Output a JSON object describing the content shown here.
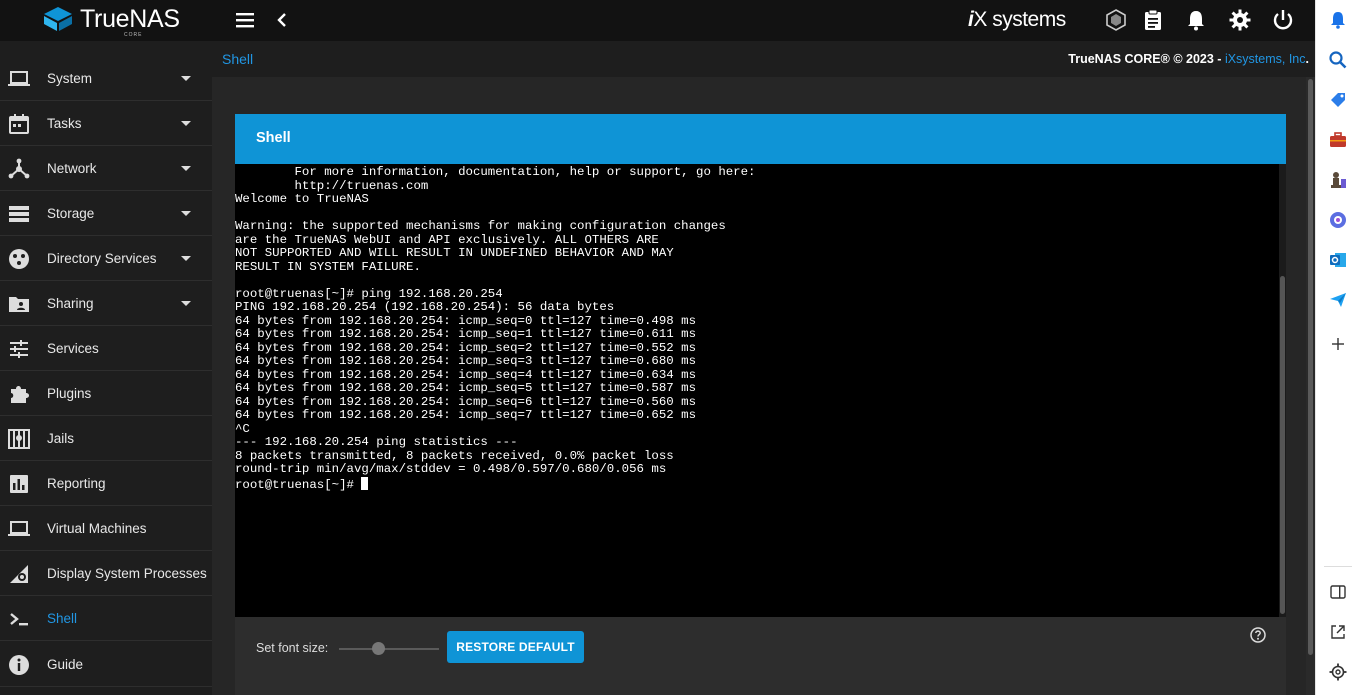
{
  "app": {
    "logo_text": "TrueNAS",
    "logo_sub": "CORE",
    "brand": "iXsystems"
  },
  "colors": {
    "accent": "#0f94d6",
    "link": "#2196e3",
    "sidebar_bg": "#1e1e1e",
    "topbar_bg": "#121212",
    "terminal_bg": "#000000"
  },
  "topbar": {
    "icons": [
      "menu-icon",
      "chevron-left-icon",
      "truecommand-icon",
      "clipboard-icon",
      "bell-icon",
      "gear-icon",
      "power-icon"
    ]
  },
  "sidebar": {
    "items": [
      {
        "label": "System",
        "icon": "laptop-icon",
        "has_caret": true
      },
      {
        "label": "Tasks",
        "icon": "calendar-icon",
        "has_caret": true
      },
      {
        "label": "Network",
        "icon": "network-icon",
        "has_caret": true
      },
      {
        "label": "Storage",
        "icon": "storage-icon",
        "has_caret": true
      },
      {
        "label": "Directory Services",
        "icon": "directory-icon",
        "has_caret": true
      },
      {
        "label": "Sharing",
        "icon": "folder-share-icon",
        "has_caret": true
      },
      {
        "label": "Services",
        "icon": "tune-icon",
        "has_caret": false
      },
      {
        "label": "Plugins",
        "icon": "puzzle-icon",
        "has_caret": false
      },
      {
        "label": "Jails",
        "icon": "jail-icon",
        "has_caret": false
      },
      {
        "label": "Reporting",
        "icon": "chart-icon",
        "has_caret": false
      },
      {
        "label": "Virtual Machines",
        "icon": "laptop-icon",
        "has_caret": false
      },
      {
        "label": "Display System Processes",
        "icon": "process-icon",
        "has_caret": false
      },
      {
        "label": "Shell",
        "icon": "console-icon",
        "has_caret": false,
        "active": true
      },
      {
        "label": "Guide",
        "icon": "info-icon",
        "has_caret": false
      }
    ]
  },
  "header": {
    "breadcrumb": "Shell",
    "copyright_prefix": "TrueNAS CORE® © 2023 - ",
    "copyright_link": "iXsystems, Inc",
    "copyright_suffix": "."
  },
  "shell": {
    "title": "Shell",
    "lines": [
      "        For more information, documentation, help or support, go here:",
      "        http://truenas.com",
      "Welcome to TrueNAS",
      "",
      "Warning: the supported mechanisms for making configuration changes",
      "are the TrueNAS WebUI and API exclusively. ALL OTHERS ARE",
      "NOT SUPPORTED AND WILL RESULT IN UNDEFINED BEHAVIOR AND MAY",
      "RESULT IN SYSTEM FAILURE.",
      "",
      "root@truenas[~]# ping 192.168.20.254",
      "PING 192.168.20.254 (192.168.20.254): 56 data bytes",
      "64 bytes from 192.168.20.254: icmp_seq=0 ttl=127 time=0.498 ms",
      "64 bytes from 192.168.20.254: icmp_seq=1 ttl=127 time=0.611 ms",
      "64 bytes from 192.168.20.254: icmp_seq=2 ttl=127 time=0.552 ms",
      "64 bytes from 192.168.20.254: icmp_seq=3 ttl=127 time=0.680 ms",
      "64 bytes from 192.168.20.254: icmp_seq=4 ttl=127 time=0.634 ms",
      "64 bytes from 192.168.20.254: icmp_seq=5 ttl=127 time=0.587 ms",
      "64 bytes from 192.168.20.254: icmp_seq=6 ttl=127 time=0.560 ms",
      "64 bytes from 192.168.20.254: icmp_seq=7 ttl=127 time=0.652 ms",
      "^C",
      "--- 192.168.20.254 ping statistics ---",
      "8 packets transmitted, 8 packets received, 0.0% packet loss",
      "round-trip min/avg/max/stddev = 0.498/0.597/0.680/0.056 ms"
    ],
    "prompt": "root@truenas[~]# ",
    "font_size_label": "Set font size:",
    "restore_label": "RESTORE DEFAULT"
  },
  "edge_sidebar": {
    "icons": [
      "bell-icon",
      "search-icon",
      "tag-icon",
      "briefcase-icon",
      "chess-icon",
      "copilot-icon",
      "outlook-icon",
      "send-icon",
      "plus-icon",
      "split-view-icon",
      "external-link-icon",
      "settings-icon"
    ]
  }
}
